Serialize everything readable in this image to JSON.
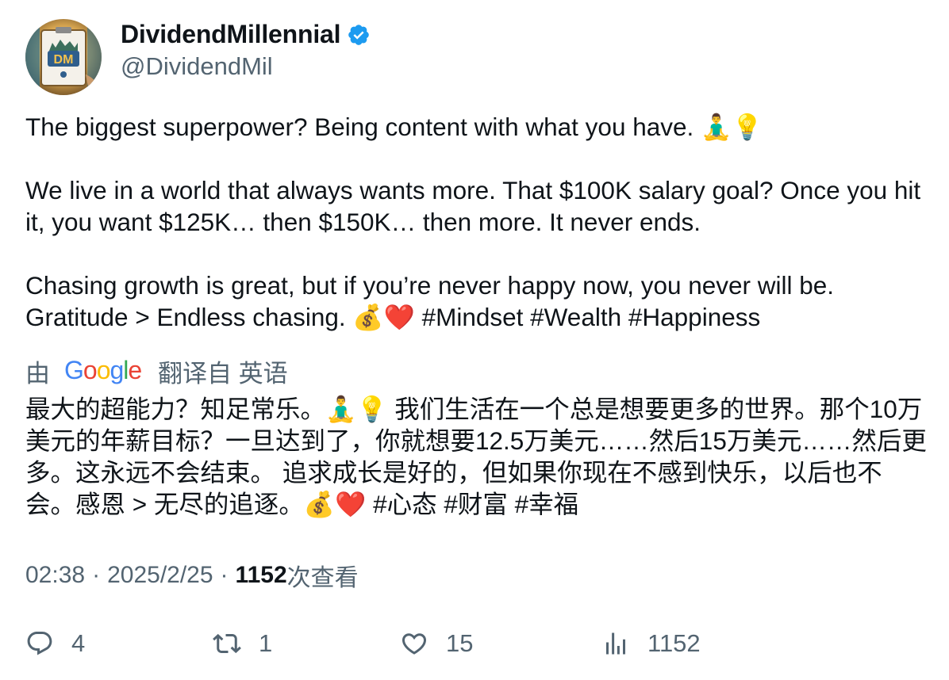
{
  "author": {
    "display_name": "DividendMillennial",
    "handle": "@DividendMil",
    "avatar_text": "DM",
    "verified_icon": "verified-badge-icon"
  },
  "tweet": {
    "line1": "The biggest superpower? Being content with what you have. 🧘‍♂️💡",
    "line2": "We live in a world that always wants more. That $100K salary goal? Once you hit it, you want $125K… then $150K… then more. It never ends.",
    "line3": "Chasing growth is great, but if you’re never happy now, you never will be. Gratitude > Endless chasing. 💰❤️ ",
    "hashtags": "#Mindset #Wealth #Happiness"
  },
  "translation": {
    "prefix": "由",
    "google_word": "Google",
    "suffix": "翻译自 英语",
    "text": "最大的超能力？知足常乐。🧘‍♂️💡 我们生活在一个总是想要更多的世界。那个10万美元的年薪目标？一旦达到了，你就想要12.5万美元……然后15万美元……然后更多。这永远不会结束。 追求成长是好的，但如果你现在不感到快乐，以后也不会。感恩 > 无尽的追逐。💰❤️ #心态 #财富 #幸福"
  },
  "meta": {
    "time": "02:38",
    "dot": "·",
    "date": "2025/2/25",
    "views_count": "1152",
    "views_label": "次查看"
  },
  "actions": {
    "replies": "4",
    "retweets": "1",
    "likes": "15",
    "views": "1152"
  },
  "colors": {
    "text": "#0f1419",
    "secondary": "#536471",
    "verified": "#1d9bf0"
  }
}
